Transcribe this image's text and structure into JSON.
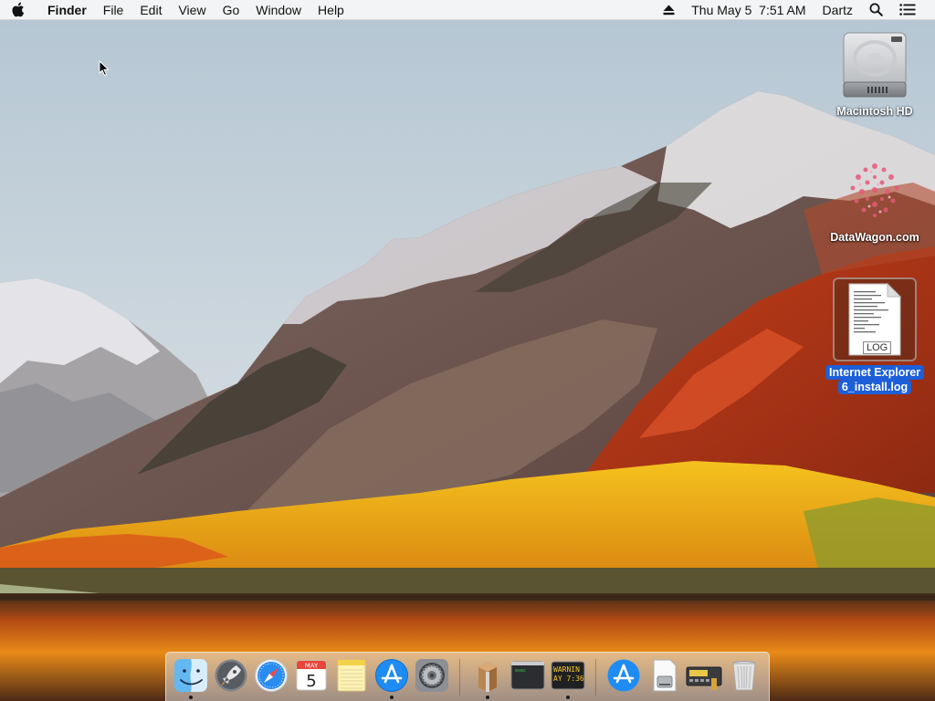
{
  "menubar": {
    "app_name": "Finder",
    "menus": [
      "File",
      "Edit",
      "View",
      "Go",
      "Window",
      "Help"
    ],
    "clock": "Thu May 5  7:51 AM",
    "user": "Dartz"
  },
  "desktop": {
    "icons": [
      {
        "label": "Macintosh HD",
        "icon": "hard-drive-icon"
      },
      {
        "label": "DataWagon.com",
        "icon": "web-location-icon"
      },
      {
        "label_line1": "Internet Explorer",
        "label_line2": "6_install.log",
        "badge": "LOG",
        "icon": "log-file-icon",
        "selected": true
      }
    ]
  },
  "dock": {
    "calendar": {
      "month": "MAY",
      "day": "5"
    },
    "console": {
      "line1": "WARNIN",
      "line2": "AY 7:36"
    },
    "terminal": {
      "text": "exec"
    },
    "items": [
      "finder-icon",
      "launchpad-icon",
      "safari-icon",
      "calendar-icon",
      "notes-icon",
      "app-store-icon",
      "system-preferences-icon",
      "archive-utility-icon",
      "terminal-icon",
      "console-icon",
      "app-store-icon",
      "disk-image-icon",
      "keychain-icon",
      "trash-icon"
    ]
  },
  "colors": {
    "selection": "#1d5fd8",
    "menubar": "#f6f6f6"
  }
}
